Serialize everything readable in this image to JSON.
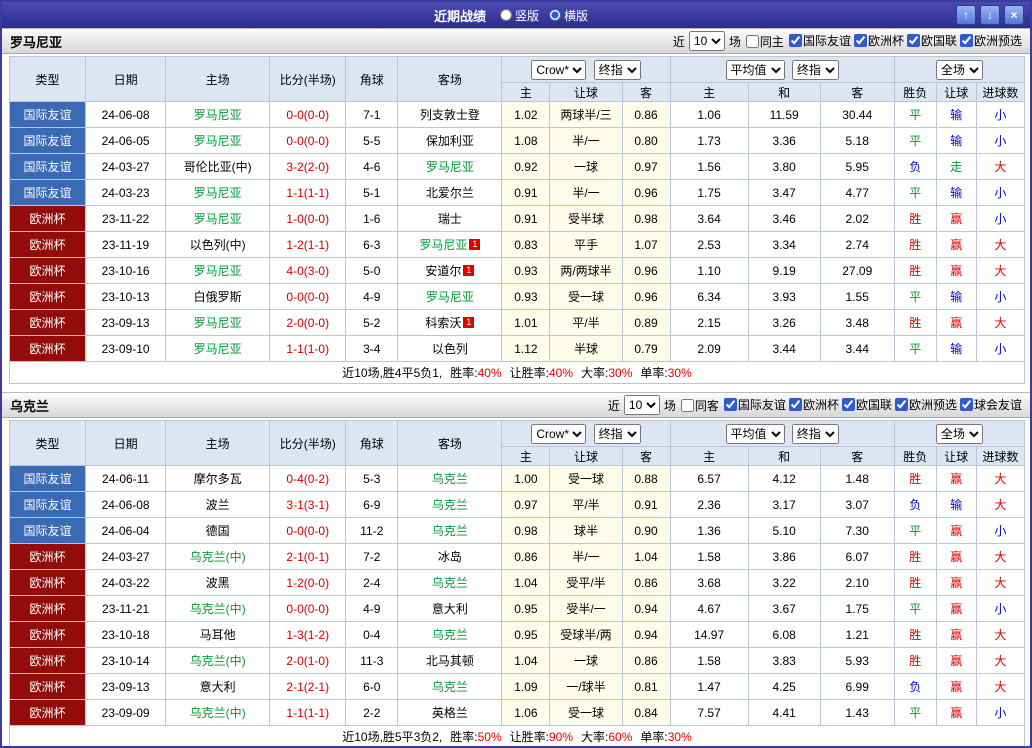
{
  "titlebar": {
    "title": "近期战绩",
    "mode_vertical": "竖版",
    "mode_horizontal": "横版",
    "selected_mode": "横版",
    "up_button": "↑",
    "down_button": "↓",
    "close_button": "×"
  },
  "table_header": {
    "type": "类型",
    "date": "日期",
    "home": "主场",
    "score": "比分(半场)",
    "corner": "角球",
    "away": "客场",
    "provider": "Crow*",
    "provider_time": "终指",
    "avg": "平均值",
    "avg_time": "终指",
    "scope": "全场",
    "sub": [
      "主",
      "让球",
      "客",
      "主",
      "和",
      "客",
      "胜负",
      "让球",
      "进球数"
    ]
  },
  "result_colors": {
    "胜": "#e60000",
    "平": "#009933",
    "负": "#0000d0",
    "赢": "#e60000",
    "输": "#0000d0",
    "走": "#009933",
    "大": "#e60000",
    "小": "#0000d0"
  },
  "sections": [
    {
      "team": "罗马尼亚",
      "filter": {
        "near_label": "近",
        "count": "10",
        "games_label": "场",
        "same_venue": "同主",
        "same_venue_checked": false,
        "checkboxes": [
          {
            "label": "国际友谊",
            "checked": true
          },
          {
            "label": "欧洲杯",
            "checked": true
          },
          {
            "label": "欧国联",
            "checked": true
          },
          {
            "label": "欧洲预选",
            "checked": true
          }
        ]
      },
      "rows": [
        {
          "type": "国际友谊",
          "league": "friendly",
          "date": "24-06-08",
          "home": "罗马尼亚",
          "home_focus": true,
          "home_badge": "",
          "score": "0-0(0-0)",
          "corner": "7-1",
          "away": "列支敦士登",
          "away_focus": false,
          "away_badge": "",
          "o1": [
            "1.02",
            "两球半/三",
            "0.86"
          ],
          "o2": [
            "1.06",
            "11.59",
            "30.44"
          ],
          "res": [
            "平",
            "输",
            "小"
          ]
        },
        {
          "type": "国际友谊",
          "league": "friendly",
          "date": "24-06-05",
          "home": "罗马尼亚",
          "home_focus": true,
          "home_badge": "",
          "score": "0-0(0-0)",
          "corner": "5-5",
          "away": "保加利亚",
          "away_focus": false,
          "away_badge": "",
          "o1": [
            "1.08",
            "半/一",
            "0.80"
          ],
          "o2": [
            "1.73",
            "3.36",
            "5.18"
          ],
          "res": [
            "平",
            "输",
            "小"
          ]
        },
        {
          "type": "国际友谊",
          "league": "friendly",
          "date": "24-03-27",
          "home": "哥伦比亚(中)",
          "home_focus": false,
          "home_badge": "",
          "score": "3-2(2-0)",
          "corner": "4-6",
          "away": "罗马尼亚",
          "away_focus": true,
          "away_badge": "",
          "o1": [
            "0.92",
            "一球",
            "0.97"
          ],
          "o2": [
            "1.56",
            "3.80",
            "5.95"
          ],
          "res": [
            "负",
            "走",
            "大"
          ]
        },
        {
          "type": "国际友谊",
          "league": "friendly",
          "date": "24-03-23",
          "home": "罗马尼亚",
          "home_focus": true,
          "home_badge": "",
          "score": "1-1(1-1)",
          "corner": "5-1",
          "away": "北爱尔兰",
          "away_focus": false,
          "away_badge": "",
          "o1": [
            "0.91",
            "半/一",
            "0.96"
          ],
          "o2": [
            "1.75",
            "3.47",
            "4.77"
          ],
          "res": [
            "平",
            "输",
            "小"
          ]
        },
        {
          "type": "欧洲杯",
          "league": "euro",
          "date": "23-11-22",
          "home": "罗马尼亚",
          "home_focus": true,
          "home_badge": "",
          "score": "1-0(0-0)",
          "corner": "1-6",
          "away": "瑞士",
          "away_focus": false,
          "away_badge": "",
          "o1": [
            "0.91",
            "受半球",
            "0.98"
          ],
          "o2": [
            "3.64",
            "3.46",
            "2.02"
          ],
          "res": [
            "胜",
            "赢",
            "小"
          ]
        },
        {
          "type": "欧洲杯",
          "league": "euro",
          "date": "23-11-19",
          "home": "以色列(中)",
          "home_focus": false,
          "home_badge": "",
          "score": "1-2(1-1)",
          "corner": "6-3",
          "away": "罗马尼亚",
          "away_focus": true,
          "away_badge": "1",
          "o1": [
            "0.83",
            "平手",
            "1.07"
          ],
          "o2": [
            "2.53",
            "3.34",
            "2.74"
          ],
          "res": [
            "胜",
            "赢",
            "大"
          ]
        },
        {
          "type": "欧洲杯",
          "league": "euro",
          "date": "23-10-16",
          "home": "罗马尼亚",
          "home_focus": true,
          "home_badge": "",
          "score": "4-0(3-0)",
          "corner": "5-0",
          "away": "安道尔",
          "away_focus": false,
          "away_badge": "1",
          "o1": [
            "0.93",
            "两/两球半",
            "0.96"
          ],
          "o2": [
            "1.10",
            "9.19",
            "27.09"
          ],
          "res": [
            "胜",
            "赢",
            "大"
          ]
        },
        {
          "type": "欧洲杯",
          "league": "euro",
          "date": "23-10-13",
          "home": "白俄罗斯",
          "home_focus": false,
          "home_badge": "",
          "score": "0-0(0-0)",
          "corner": "4-9",
          "away": "罗马尼亚",
          "away_focus": true,
          "away_badge": "",
          "o1": [
            "0.93",
            "受一球",
            "0.96"
          ],
          "o2": [
            "6.34",
            "3.93",
            "1.55"
          ],
          "res": [
            "平",
            "输",
            "小"
          ]
        },
        {
          "type": "欧洲杯",
          "league": "euro",
          "date": "23-09-13",
          "home": "罗马尼亚",
          "home_focus": true,
          "home_badge": "",
          "score": "2-0(0-0)",
          "corner": "5-2",
          "away": "科索沃",
          "away_focus": false,
          "away_badge": "1",
          "o1": [
            "1.01",
            "平/半",
            "0.89"
          ],
          "o2": [
            "2.15",
            "3.26",
            "3.48"
          ],
          "res": [
            "胜",
            "赢",
            "大"
          ]
        },
        {
          "type": "欧洲杯",
          "league": "euro",
          "date": "23-09-10",
          "home": "罗马尼亚",
          "home_focus": true,
          "home_badge": "",
          "score": "1-1(1-0)",
          "corner": "3-4",
          "away": "以色列",
          "away_focus": false,
          "away_badge": "",
          "o1": [
            "1.12",
            "半球",
            "0.79"
          ],
          "o2": [
            "2.09",
            "3.44",
            "3.44"
          ],
          "res": [
            "平",
            "输",
            "小"
          ]
        }
      ],
      "summary": {
        "prefix": "近10场,胜4平5负1,",
        "stats": [
          {
            "label": "胜率:",
            "value": "40%"
          },
          {
            "label": "让胜率:",
            "value": "40%"
          },
          {
            "label": "大率:",
            "value": "30%"
          },
          {
            "label": "单率:",
            "value": "30%"
          }
        ]
      }
    },
    {
      "team": "乌克兰",
      "filter": {
        "near_label": "近",
        "count": "10",
        "games_label": "场",
        "same_venue": "同客",
        "same_venue_checked": false,
        "checkboxes": [
          {
            "label": "国际友谊",
            "checked": true
          },
          {
            "label": "欧洲杯",
            "checked": true
          },
          {
            "label": "欧国联",
            "checked": true
          },
          {
            "label": "欧洲预选",
            "checked": true
          },
          {
            "label": "球会友谊",
            "checked": true
          }
        ]
      },
      "rows": [
        {
          "type": "国际友谊",
          "league": "friendly",
          "date": "24-06-11",
          "home": "摩尔多瓦",
          "home_focus": false,
          "home_badge": "",
          "score": "0-4(0-2)",
          "corner": "5-3",
          "away": "乌克兰",
          "away_focus": true,
          "away_badge": "",
          "o1": [
            "1.00",
            "受一球",
            "0.88"
          ],
          "o2": [
            "6.57",
            "4.12",
            "1.48"
          ],
          "res": [
            "胜",
            "赢",
            "大"
          ]
        },
        {
          "type": "国际友谊",
          "league": "friendly",
          "date": "24-06-08",
          "home": "波兰",
          "home_focus": false,
          "home_badge": "",
          "score": "3-1(3-1)",
          "corner": "6-9",
          "away": "乌克兰",
          "away_focus": true,
          "away_badge": "",
          "o1": [
            "0.97",
            "平/半",
            "0.91"
          ],
          "o2": [
            "2.36",
            "3.17",
            "3.07"
          ],
          "res": [
            "负",
            "输",
            "大"
          ]
        },
        {
          "type": "国际友谊",
          "league": "friendly",
          "date": "24-06-04",
          "home": "德国",
          "home_focus": false,
          "home_badge": "",
          "score": "0-0(0-0)",
          "corner": "11-2",
          "away": "乌克兰",
          "away_focus": true,
          "away_badge": "",
          "o1": [
            "0.98",
            "球半",
            "0.90"
          ],
          "o2": [
            "1.36",
            "5.10",
            "7.30"
          ],
          "res": [
            "平",
            "赢",
            "小"
          ]
        },
        {
          "type": "欧洲杯",
          "league": "euro",
          "date": "24-03-27",
          "home": "乌克兰(中)",
          "home_focus": true,
          "home_badge": "",
          "score": "2-1(0-1)",
          "corner": "7-2",
          "away": "冰岛",
          "away_focus": false,
          "away_badge": "",
          "o1": [
            "0.86",
            "半/一",
            "1.04"
          ],
          "o2": [
            "1.58",
            "3.86",
            "6.07"
          ],
          "res": [
            "胜",
            "赢",
            "大"
          ]
        },
        {
          "type": "欧洲杯",
          "league": "euro",
          "date": "24-03-22",
          "home": "波黑",
          "home_focus": false,
          "home_badge": "",
          "score": "1-2(0-0)",
          "corner": "2-4",
          "away": "乌克兰",
          "away_focus": true,
          "away_badge": "",
          "o1": [
            "1.04",
            "受平/半",
            "0.86"
          ],
          "o2": [
            "3.68",
            "3.22",
            "2.10"
          ],
          "res": [
            "胜",
            "赢",
            "大"
          ]
        },
        {
          "type": "欧洲杯",
          "league": "euro",
          "date": "23-11-21",
          "home": "乌克兰(中)",
          "home_focus": true,
          "home_badge": "",
          "score": "0-0(0-0)",
          "corner": "4-9",
          "away": "意大利",
          "away_focus": false,
          "away_badge": "",
          "o1": [
            "0.95",
            "受半/一",
            "0.94"
          ],
          "o2": [
            "4.67",
            "3.67",
            "1.75"
          ],
          "res": [
            "平",
            "赢",
            "小"
          ]
        },
        {
          "type": "欧洲杯",
          "league": "euro",
          "date": "23-10-18",
          "home": "马耳他",
          "home_focus": false,
          "home_badge": "",
          "score": "1-3(1-2)",
          "corner": "0-4",
          "away": "乌克兰",
          "away_focus": true,
          "away_badge": "",
          "o1": [
            "0.95",
            "受球半/两",
            "0.94"
          ],
          "o2": [
            "14.97",
            "6.08",
            "1.21"
          ],
          "res": [
            "胜",
            "赢",
            "大"
          ]
        },
        {
          "type": "欧洲杯",
          "league": "euro",
          "date": "23-10-14",
          "home": "乌克兰(中)",
          "home_focus": true,
          "home_badge": "",
          "score": "2-0(1-0)",
          "corner": "11-3",
          "away": "北马其顿",
          "away_focus": false,
          "away_badge": "",
          "o1": [
            "1.04",
            "一球",
            "0.86"
          ],
          "o2": [
            "1.58",
            "3.83",
            "5.93"
          ],
          "res": [
            "胜",
            "赢",
            "大"
          ]
        },
        {
          "type": "欧洲杯",
          "league": "euro",
          "date": "23-09-13",
          "home": "意大利",
          "home_focus": false,
          "home_badge": "",
          "score": "2-1(2-1)",
          "corner": "6-0",
          "away": "乌克兰",
          "away_focus": true,
          "away_badge": "",
          "o1": [
            "1.09",
            "一/球半",
            "0.81"
          ],
          "o2": [
            "1.47",
            "4.25",
            "6.99"
          ],
          "res": [
            "负",
            "赢",
            "大"
          ]
        },
        {
          "type": "欧洲杯",
          "league": "euro",
          "date": "23-09-09",
          "home": "乌克兰(中)",
          "home_focus": true,
          "home_badge": "",
          "score": "1-1(1-1)",
          "corner": "2-2",
          "away": "英格兰",
          "away_focus": false,
          "away_badge": "",
          "o1": [
            "1.06",
            "受一球",
            "0.84"
          ],
          "o2": [
            "7.57",
            "4.41",
            "1.43"
          ],
          "res": [
            "平",
            "赢",
            "小"
          ]
        }
      ],
      "summary": {
        "prefix": "近10场,胜5平3负2,",
        "stats": [
          {
            "label": "胜率:",
            "value": "50%"
          },
          {
            "label": "让胜率:",
            "value": "90%"
          },
          {
            "label": "大率:",
            "value": "60%"
          },
          {
            "label": "单率:",
            "value": "30%"
          }
        ]
      }
    }
  ]
}
